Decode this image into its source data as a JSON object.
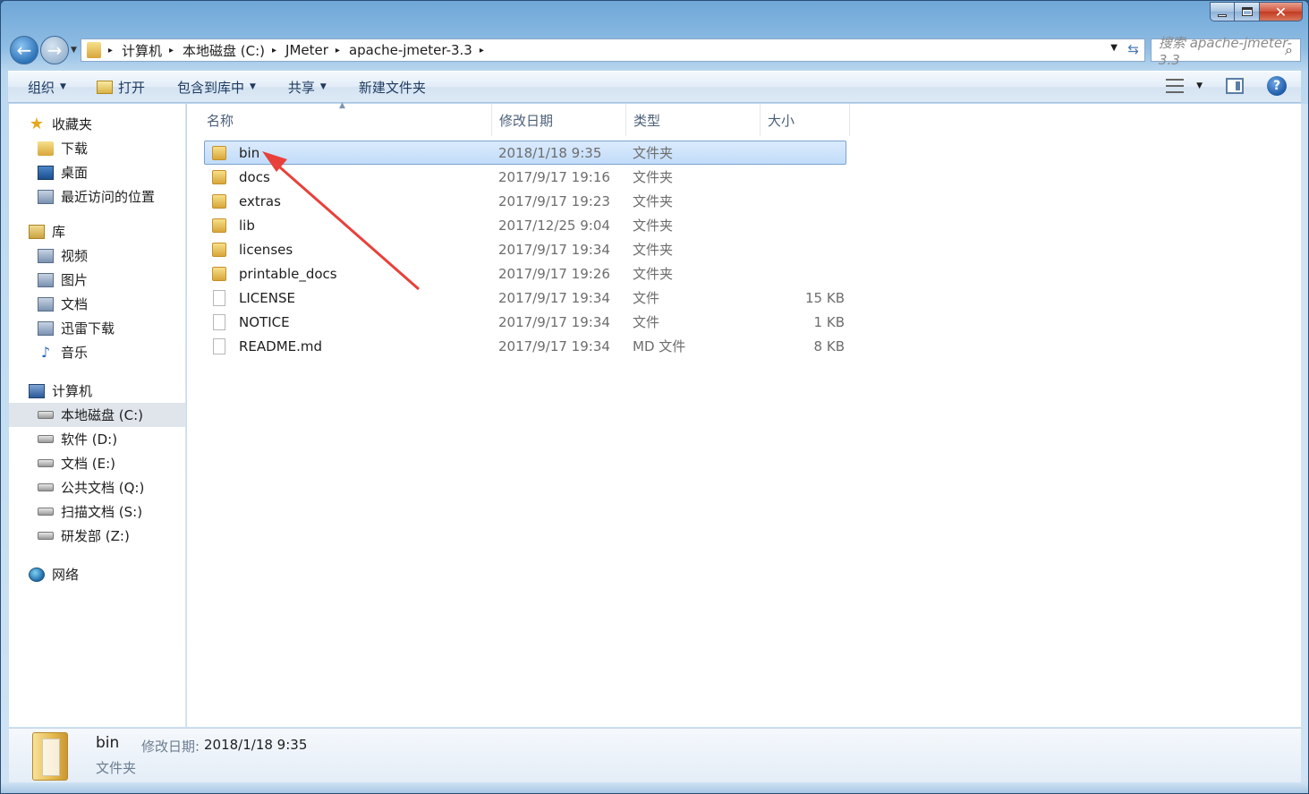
{
  "window": {
    "close_glyph": "✕"
  },
  "nav": {
    "back_glyph": "←",
    "forward_glyph": "→"
  },
  "address": {
    "crumbs": [
      "计算机",
      "本地磁盘 (C:)",
      "JMeter",
      "apache-jmeter-3.3"
    ],
    "separator": "▸"
  },
  "search": {
    "placeholder": "搜索 apache-jmeter-3.3"
  },
  "toolbar": {
    "organize": "组织",
    "open": "打开",
    "include_library": "包含到库中",
    "share": "共享",
    "new_folder": "新建文件夹"
  },
  "sidebar": {
    "favorites": {
      "label": "收藏夹",
      "items": [
        "下载",
        "桌面",
        "最近访问的位置"
      ]
    },
    "libraries": {
      "label": "库",
      "items": [
        "视频",
        "图片",
        "文档",
        "迅雷下载",
        "音乐"
      ]
    },
    "computer": {
      "label": "计算机",
      "items": [
        "本地磁盘 (C:)",
        "软件 (D:)",
        "文档 (E:)",
        "公共文档 (Q:)",
        "扫描文档 (S:)",
        "研发部 (Z:)"
      ]
    },
    "network": {
      "label": "网络"
    }
  },
  "columns": {
    "name": "名称",
    "date": "修改日期",
    "type": "类型",
    "size": "大小"
  },
  "files": [
    {
      "name": "bin",
      "date": "2018/1/18 9:35",
      "type": "文件夹",
      "size": ""
    },
    {
      "name": "docs",
      "date": "2017/9/17 19:16",
      "type": "文件夹",
      "size": ""
    },
    {
      "name": "extras",
      "date": "2017/9/17 19:23",
      "type": "文件夹",
      "size": ""
    },
    {
      "name": "lib",
      "date": "2017/12/25 9:04",
      "type": "文件夹",
      "size": ""
    },
    {
      "name": "licenses",
      "date": "2017/9/17 19:34",
      "type": "文件夹",
      "size": ""
    },
    {
      "name": "printable_docs",
      "date": "2017/9/17 19:26",
      "type": "文件夹",
      "size": ""
    },
    {
      "name": "LICENSE",
      "date": "2017/9/17 19:34",
      "type": "文件",
      "size": "15 KB"
    },
    {
      "name": "NOTICE",
      "date": "2017/9/17 19:34",
      "type": "文件",
      "size": "1 KB"
    },
    {
      "name": "README.md",
      "date": "2017/9/17 19:34",
      "type": "MD 文件",
      "size": "8 KB"
    }
  ],
  "details": {
    "name": "bin",
    "modified_label": "修改日期:",
    "modified_value": "2018/1/18 9:35",
    "type": "文件夹"
  },
  "annotation": {
    "arrow_color": "#e8403a"
  }
}
